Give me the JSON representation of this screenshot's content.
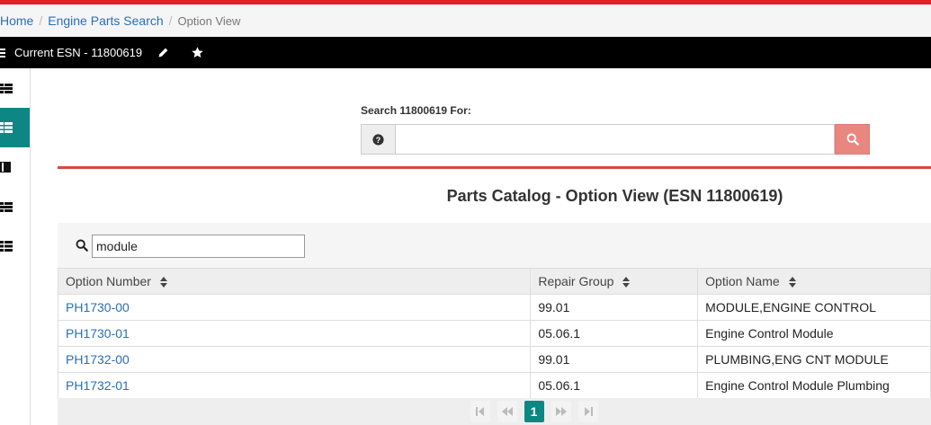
{
  "breadcrumb": {
    "home": "Home",
    "search": "Engine Parts Search",
    "current": "Option View"
  },
  "esn_bar": {
    "label": "Current ESN - 11800619",
    "icons": [
      "hamburger-icon",
      "pencil-icon",
      "star-icon"
    ]
  },
  "sidebar": {
    "items": [
      {
        "icon": "list-detail-icon",
        "active": false
      },
      {
        "icon": "list-icon",
        "active": true
      },
      {
        "icon": "book-icon",
        "active": false
      },
      {
        "icon": "list-detail-icon",
        "active": false
      },
      {
        "icon": "list-icon",
        "active": false
      }
    ],
    "active_color": "#0d8784"
  },
  "search": {
    "label": "Search 11800619 For:",
    "value": "",
    "help_icon": "question-circle-icon",
    "button_icon": "search-icon",
    "button_color": "#e9867f"
  },
  "panel": {
    "title": "Parts Catalog - Option View (ESN 11800619)",
    "filter_value": "module",
    "accent_color": "#d9473c"
  },
  "table": {
    "columns": [
      "Option Number",
      "Repair Group",
      "Option Name"
    ],
    "rows": [
      {
        "option_number": "PH1730-00",
        "repair_group": "99.01",
        "option_name": "MODULE,ENGINE CONTROL"
      },
      {
        "option_number": "PH1730-01",
        "repair_group": "05.06.1",
        "option_name": "Engine Control Module"
      },
      {
        "option_number": "PH1732-00",
        "repair_group": "99.01",
        "option_name": "PLUMBING,ENG CNT MODULE"
      },
      {
        "option_number": "PH1732-01",
        "repair_group": "05.06.1",
        "option_name": "Engine Control Module Plumbing"
      }
    ]
  },
  "pager": {
    "current_page": "1"
  }
}
